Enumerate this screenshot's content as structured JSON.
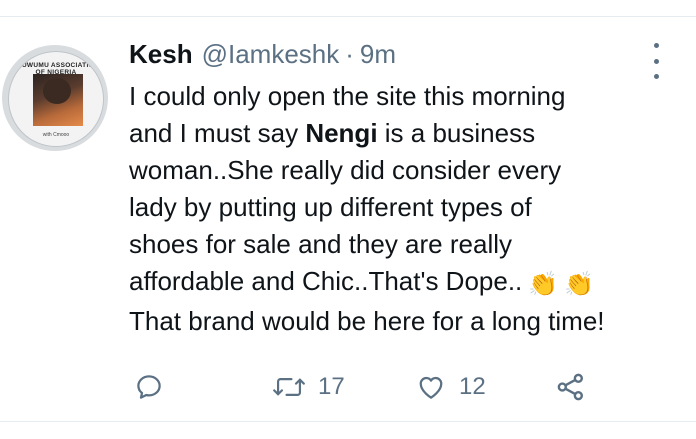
{
  "tweet": {
    "author_name": "Kesh",
    "author_handle": "@Iamkeshk",
    "separator": "·",
    "time": "9m",
    "avatar": {
      "top_text": "IE UWUMU ASSOCIATION OF NIGERIA",
      "bottom_text": "with Cmooo"
    },
    "lines": [
      "I could only open the site this morning",
      {
        "pre": "and I must say ",
        "bold": "Nengi",
        "post": " is a business"
      },
      "woman..She really did consider every",
      "lady by putting up different types of",
      "shoes for sale and they are really",
      "affordable and Chic..That's Dope..",
      "That brand would be here for a long time!"
    ],
    "emojis": [
      "👏",
      "👏"
    ],
    "actions": {
      "reply_icon": "reply-icon",
      "retweet_icon": "retweet-icon",
      "retweet_count": "17",
      "like_icon": "heart-icon",
      "like_count": "12",
      "share_icon": "share-icon"
    }
  },
  "colors": {
    "text": "#0f1419",
    "secondary": "#5b7083",
    "divider": "#e6ecf0"
  }
}
